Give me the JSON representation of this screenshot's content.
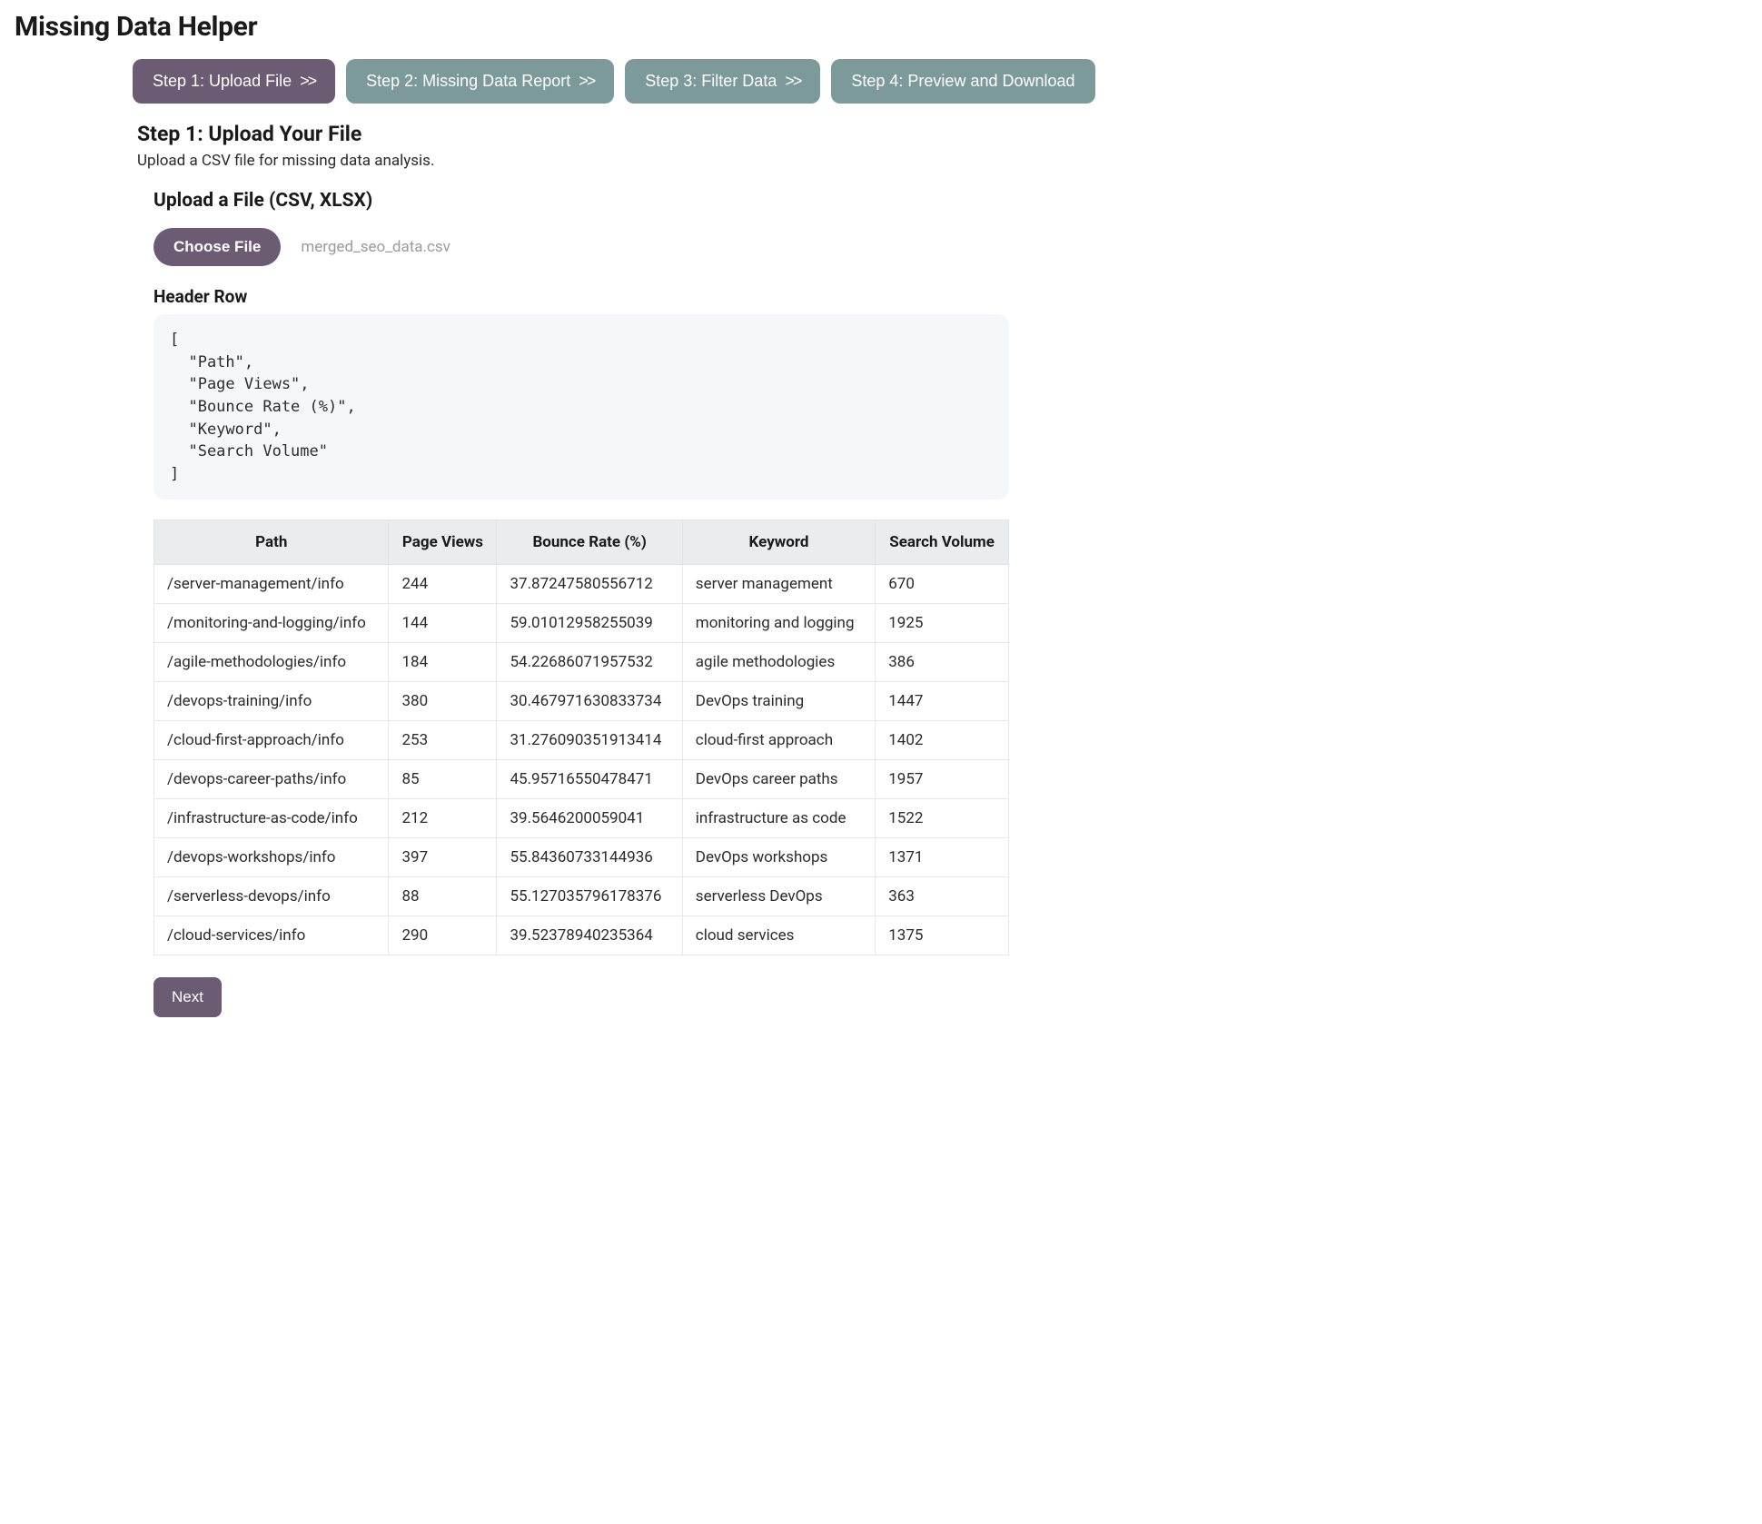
{
  "title": "Missing Data Helper",
  "steps": [
    {
      "label": "Step 1: Upload File",
      "active": true,
      "chevron": ">>"
    },
    {
      "label": "Step 2: Missing Data Report",
      "active": false,
      "chevron": ">>"
    },
    {
      "label": "Step 3: Filter Data",
      "active": false,
      "chevron": ">>"
    },
    {
      "label": "Step 4: Preview and Download",
      "active": false,
      "chevron": ""
    }
  ],
  "step_heading": "Step 1: Upload Your File",
  "step_sub": "Upload a CSV file for missing data analysis.",
  "upload": {
    "label": "Upload a File (CSV, XLSX)",
    "choose_label": "Choose File",
    "file_name": "merged_seo_data.csv"
  },
  "header_row_label": "Header Row",
  "header_row_code": "[\n  \"Path\",\n  \"Page Views\",\n  \"Bounce Rate (%)\",\n  \"Keyword\",\n  \"Search Volume\"\n]",
  "table": {
    "columns": [
      "Path",
      "Page Views",
      "Bounce Rate (%)",
      "Keyword",
      "Search Volume"
    ],
    "rows": [
      {
        "path": "/server-management/info",
        "page_views": "244",
        "bounce": "37.87247580556712",
        "keyword": "server management",
        "volume": "670"
      },
      {
        "path": "/monitoring-and-logging/info",
        "page_views": "144",
        "bounce": "59.01012958255039",
        "keyword": "monitoring and logging",
        "volume": "1925"
      },
      {
        "path": "/agile-methodologies/info",
        "page_views": "184",
        "bounce": "54.22686071957532",
        "keyword": "agile methodologies",
        "volume": "386"
      },
      {
        "path": "/devops-training/info",
        "page_views": "380",
        "bounce": "30.467971630833734",
        "keyword": "DevOps training",
        "volume": "1447"
      },
      {
        "path": "/cloud-first-approach/info",
        "page_views": "253",
        "bounce": "31.276090351913414",
        "keyword": "cloud-first approach",
        "volume": "1402"
      },
      {
        "path": "/devops-career-paths/info",
        "page_views": "85",
        "bounce": "45.95716550478471",
        "keyword": "DevOps career paths",
        "volume": "1957"
      },
      {
        "path": "/infrastructure-as-code/info",
        "page_views": "212",
        "bounce": "39.5646200059041",
        "keyword": "infrastructure as code",
        "volume": "1522"
      },
      {
        "path": "/devops-workshops/info",
        "page_views": "397",
        "bounce": "55.84360733144936",
        "keyword": "DevOps workshops",
        "volume": "1371"
      },
      {
        "path": "/serverless-devops/info",
        "page_views": "88",
        "bounce": "55.127035796178376",
        "keyword": "serverless DevOps",
        "volume": "363"
      },
      {
        "path": "/cloud-services/info",
        "page_views": "290",
        "bounce": "39.52378940235364",
        "keyword": "cloud services",
        "volume": "1375"
      }
    ]
  },
  "next_label": "Next"
}
